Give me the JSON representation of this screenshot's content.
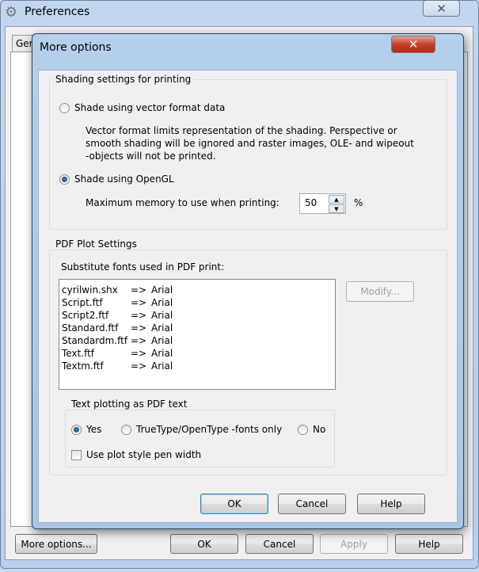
{
  "preferences": {
    "title": "Preferences",
    "tab_partial": "Ger",
    "buttons": {
      "more_options": "More options...",
      "ok": "OK",
      "cancel": "Cancel",
      "apply": "Apply",
      "help": "Help"
    }
  },
  "dialog": {
    "title": "More options",
    "shading": {
      "group_label": "Shading settings for printing",
      "vector_label": "Shade using vector format data",
      "vector_desc": [
        "Vector format limits representation of the shading. Perspective or",
        "smooth shading will be ignored and raster images, OLE- and wipeout",
        "-objects will not be printed."
      ],
      "opengl_label": "Shade using OpenGL",
      "selected": "opengl",
      "memory_label": "Maximum memory to use when printing:",
      "memory_value": "50",
      "memory_unit": "%"
    },
    "pdf": {
      "group_label": "PDF Plot Settings",
      "fonts_label": "Substitute fonts used in PDF print:",
      "fonts": [
        {
          "from": "cyrilwin.shx",
          "to": "Arial"
        },
        {
          "from": "Script.ftf",
          "to": "Arial"
        },
        {
          "from": "Script2.ftf",
          "to": "Arial"
        },
        {
          "from": "Standard.ftf",
          "to": "Arial"
        },
        {
          "from": "Standardm.ftf",
          "to": "Arial"
        },
        {
          "from": "Text.ftf",
          "to": "Arial"
        },
        {
          "from": "Textm.ftf",
          "to": "Arial"
        }
      ],
      "arrow": "=>",
      "modify": "Modify...",
      "text_group_label": "Text plotting as PDF text",
      "options": [
        "Yes",
        "TrueType/OpenType -fonts only",
        "No"
      ],
      "selected": "Yes",
      "pen_width_label": "Use plot style pen width",
      "pen_width_checked": false
    },
    "buttons": {
      "ok": "OK",
      "cancel": "Cancel",
      "help": "Help"
    }
  }
}
